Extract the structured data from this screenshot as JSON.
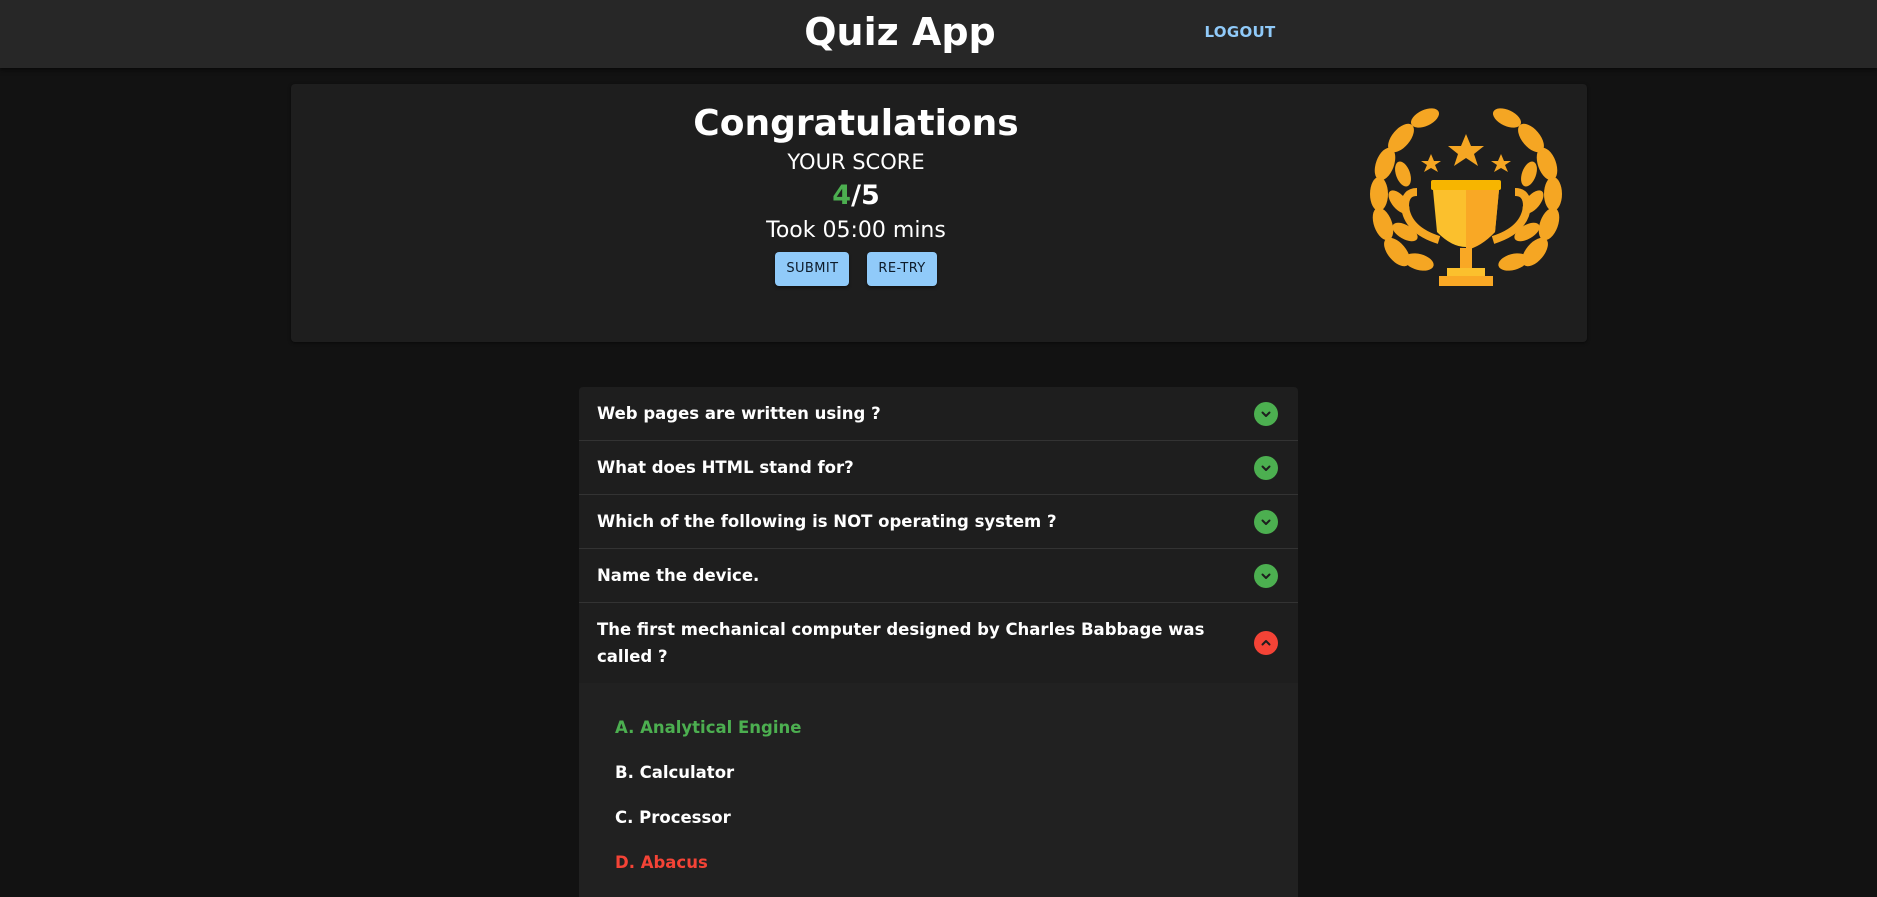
{
  "app": {
    "title": "Quiz App",
    "logout_label": "LOGOUT"
  },
  "result": {
    "heading": "Congratulations",
    "score_label": "YOUR SCORE",
    "score_correct": "4",
    "score_separator": "/",
    "score_total": "5",
    "time_text": "Took 05:00 mins",
    "submit_label": "SUBMIT",
    "retry_label": "RE-TRY",
    "icon": "trophy-icon"
  },
  "questions": [
    {
      "text": "Web pages are written using ?",
      "status": "correct",
      "expanded": false
    },
    {
      "text": "What does HTML stand for?",
      "status": "correct",
      "expanded": false
    },
    {
      "text": "Which of the following is NOT operating system ?",
      "status": "correct",
      "expanded": false
    },
    {
      "text": "Name the device.",
      "status": "correct",
      "expanded": false
    },
    {
      "text": "The first mechanical computer designed by Charles Babbage was called ?",
      "status": "wrong",
      "expanded": true,
      "options": [
        {
          "label": "A. Analytical Engine",
          "state": "correct"
        },
        {
          "label": "B. Calculator",
          "state": "neutral"
        },
        {
          "label": "C. Processor",
          "state": "neutral"
        },
        {
          "label": "D. Abacus",
          "state": "wrong"
        }
      ]
    }
  ],
  "colors": {
    "correct": "#4caf50",
    "wrong": "#f44336",
    "accent": "#90caf9"
  }
}
